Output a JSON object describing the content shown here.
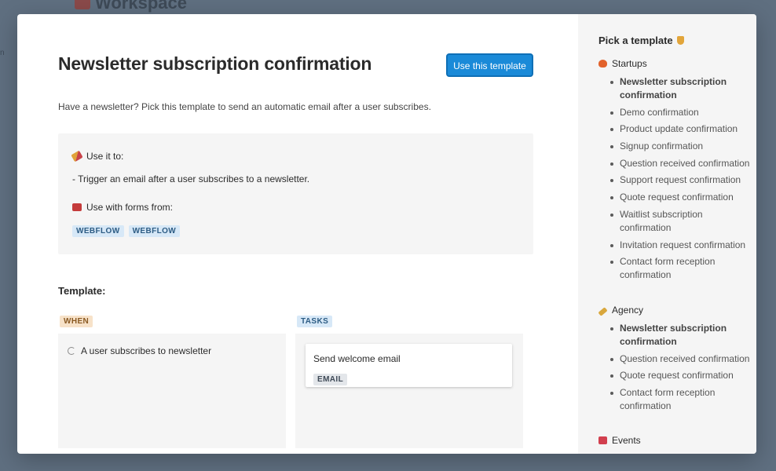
{
  "background": {
    "title": "Workspace"
  },
  "modal": {
    "title": "Newsletter subscription confirmation",
    "use_button": "Use this template",
    "description": "Have a newsletter? Pick this template to send an automatic email after a user subscribes.",
    "info": {
      "use_it_to_label": "Use it to:",
      "use_it_to_text": "- Trigger an email after a user subscribes to a newsletter.",
      "forms_label": "Use with forms from:",
      "form_tags": [
        "WEBFLOW",
        "WEBFLOW"
      ]
    },
    "template_label": "Template:",
    "when": {
      "label": "WHEN",
      "trigger": "A user subscribes to newsletter"
    },
    "tasks": {
      "label": "TASKS",
      "task_title": "Send welcome email",
      "task_tag": "EMAIL"
    }
  },
  "sidebar": {
    "title": "Pick a template",
    "categories": [
      {
        "name": "Startups",
        "icon": "fire-icon",
        "items": [
          "Newsletter subscription confirmation",
          "Demo confirmation",
          "Product update confirmation",
          "Signup confirmation",
          "Question received confirmation",
          "Support request confirmation",
          "Quote request confirmation",
          "Waitlist subscription confirmation",
          "Invitation request confirmation",
          "Contact form reception confirmation"
        ]
      },
      {
        "name": "Agency",
        "icon": "paintbrush-icon",
        "items": [
          "Newsletter subscription confirmation",
          "Question received confirmation",
          "Quote request confirmation",
          "Contact form reception confirmation"
        ]
      },
      {
        "name": "Events",
        "icon": "ticket-icon",
        "items": []
      }
    ]
  },
  "colors": {
    "accent": "#1a8ad8",
    "backdrop": "#5f6f80",
    "panel": "#f5f5f5"
  }
}
